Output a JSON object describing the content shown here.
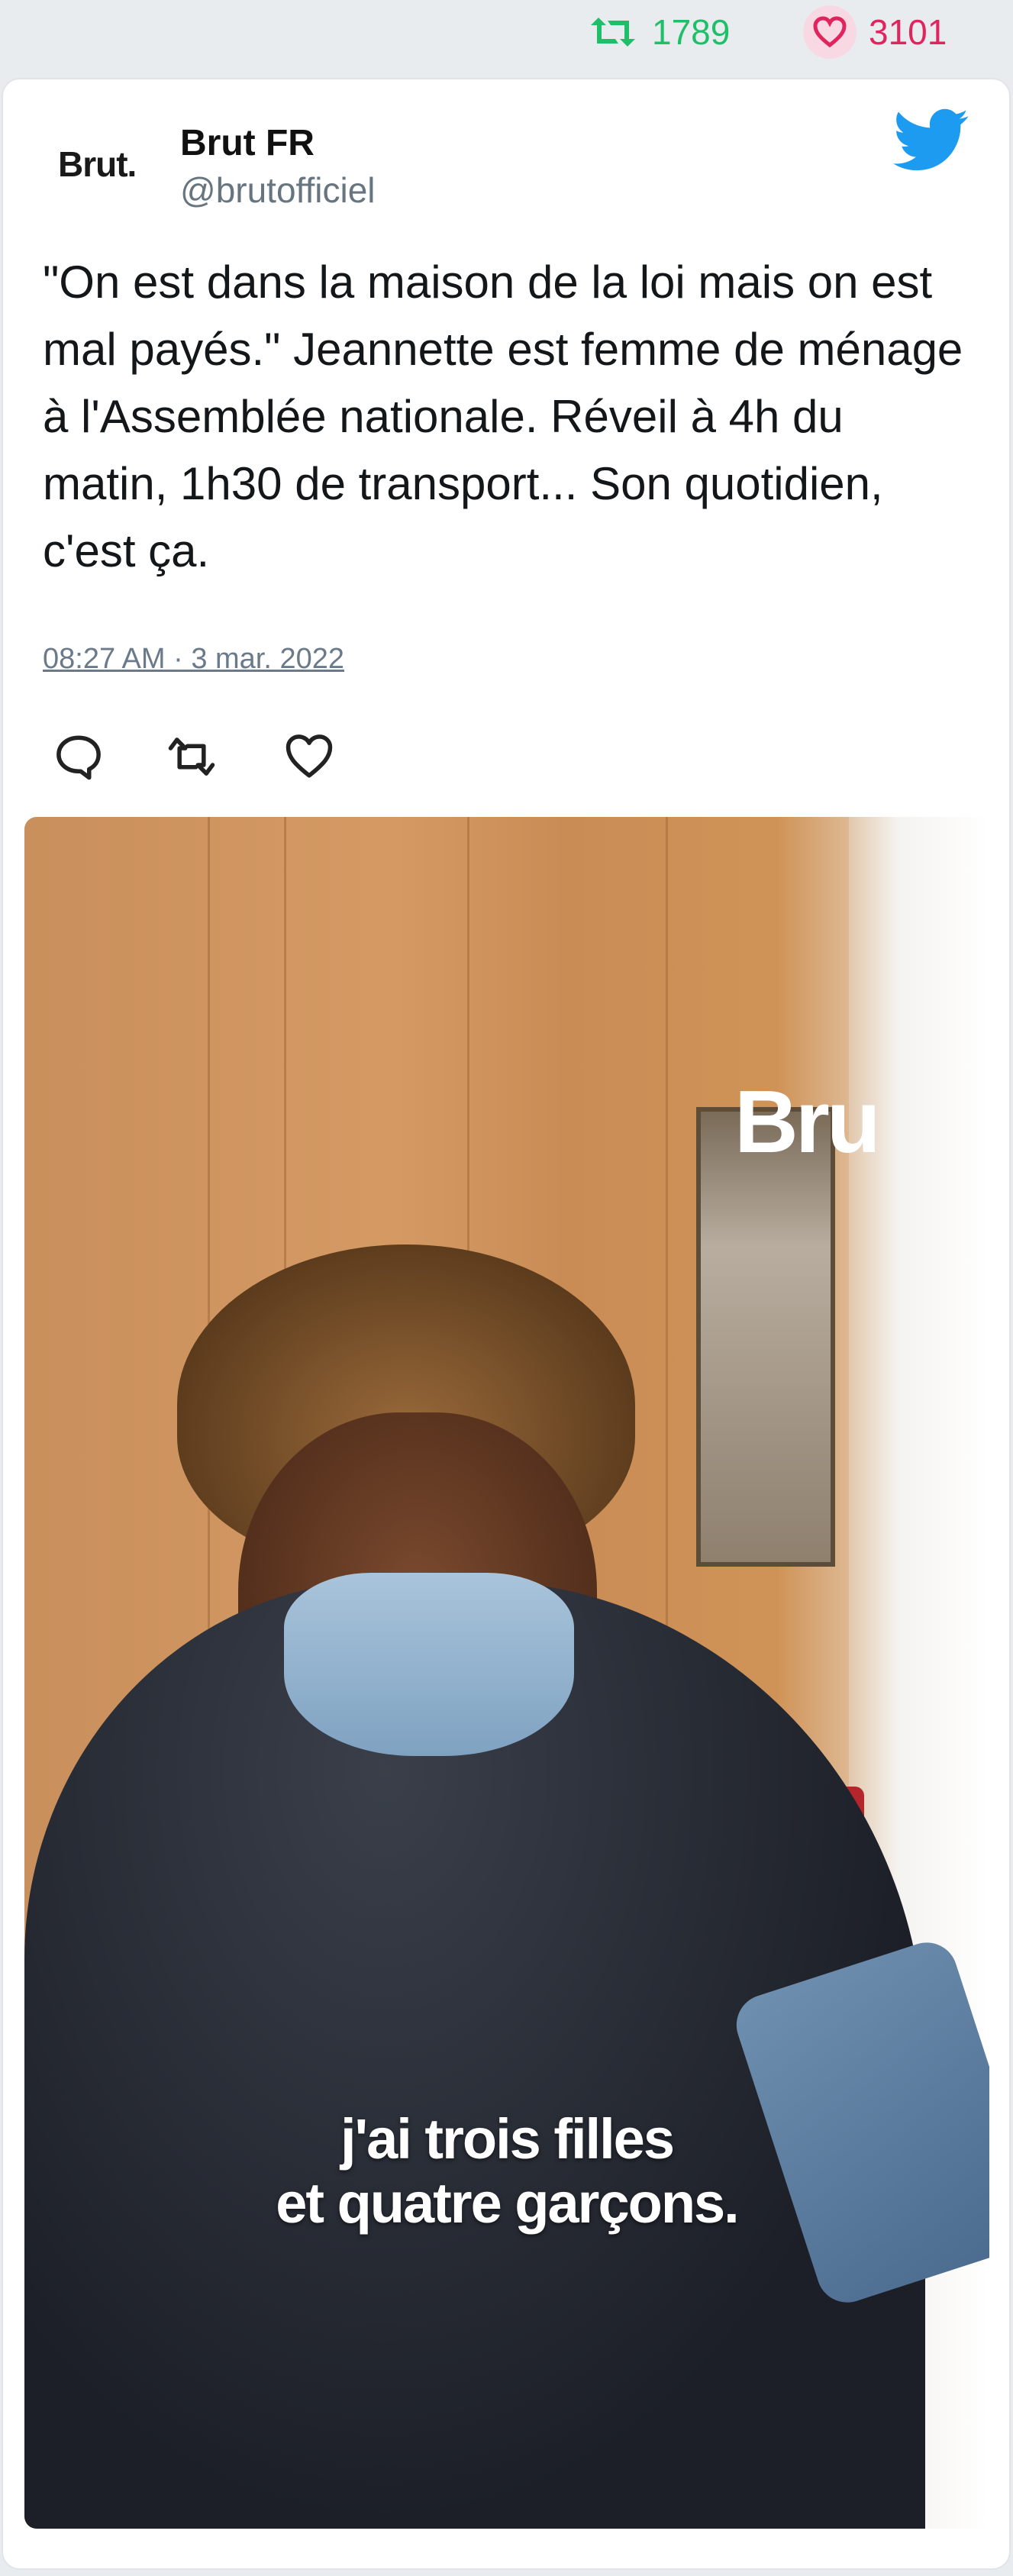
{
  "stats": {
    "retweets": "1789",
    "likes": "3101",
    "retweet_icon": "retweet-icon",
    "like_icon": "heart-icon"
  },
  "tweet": {
    "author_name": "Brut FR",
    "handle": "@brutofficiel",
    "logo_text": "Brut.",
    "platform_icon": "twitter-bird-icon",
    "text": "\"On est dans la maison de la loi mais on est mal payés.\" Jeannette est femme de ménage à l'Assemblée nationale. Réveil à 4h du matin, 1h30 de transport... Son quotidien, c'est ça.",
    "timestamp": "08:27 AM · 3 mar. 2022",
    "actions": [
      "reply-icon",
      "retweet-icon",
      "like-icon"
    ]
  },
  "media": {
    "watermark": "Bru",
    "caption_line1": "j'ai trois filles",
    "caption_line2": "et quatre garçons."
  },
  "colors": {
    "retweet_green": "#1fbf6a",
    "like_pink": "#e0245e",
    "twitter_blue": "#1d9bf0"
  }
}
